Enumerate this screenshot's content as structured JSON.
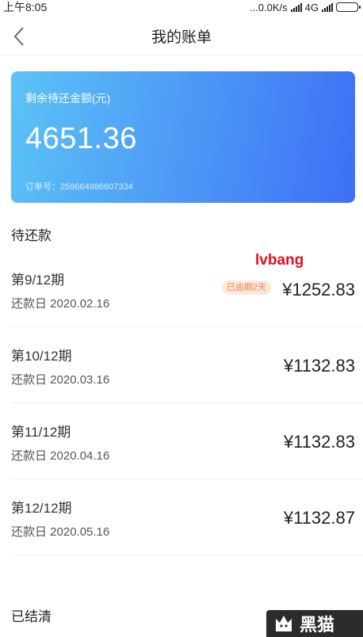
{
  "status_bar": {
    "time": "上午8:05",
    "network_speed": "...0.0K/s",
    "network_type": "4G",
    "battery_level": 1.0,
    "icons": [
      "signal-icon",
      "signal-icon",
      "battery-icon"
    ]
  },
  "header": {
    "title": "我的账单",
    "back_icon": "chevron-left-icon"
  },
  "summary": {
    "label": "剩余待还金额(元)",
    "amount": "4651.36",
    "order_no": "订单号：259664986607334",
    "gradient": [
      "#5cc3f6",
      "#3d6ff5"
    ]
  },
  "watermark": "lvbang",
  "pending": {
    "title": "待还款",
    "bills": [
      {
        "period": "第9/12期",
        "due": "还款日 2020.02.16",
        "amount": "¥1252.83",
        "badge": "已逾期2天"
      },
      {
        "period": "第10/12期",
        "due": "还款日 2020.03.16",
        "amount": "¥1132.83",
        "badge": ""
      },
      {
        "period": "第11/12期",
        "due": "还款日 2020.04.16",
        "amount": "¥1132.83",
        "badge": ""
      },
      {
        "period": "第12/12期",
        "due": "还款日 2020.05.16",
        "amount": "¥1132.87",
        "badge": ""
      }
    ]
  },
  "settled": {
    "title": "已结清"
  },
  "corner_logo": {
    "text": "黑猫",
    "icon": "cat-logo-icon"
  },
  "colors": {
    "overdue_text": "#f1884a",
    "overdue_bg": "#fde8dc",
    "watermark": "#e0111c"
  }
}
